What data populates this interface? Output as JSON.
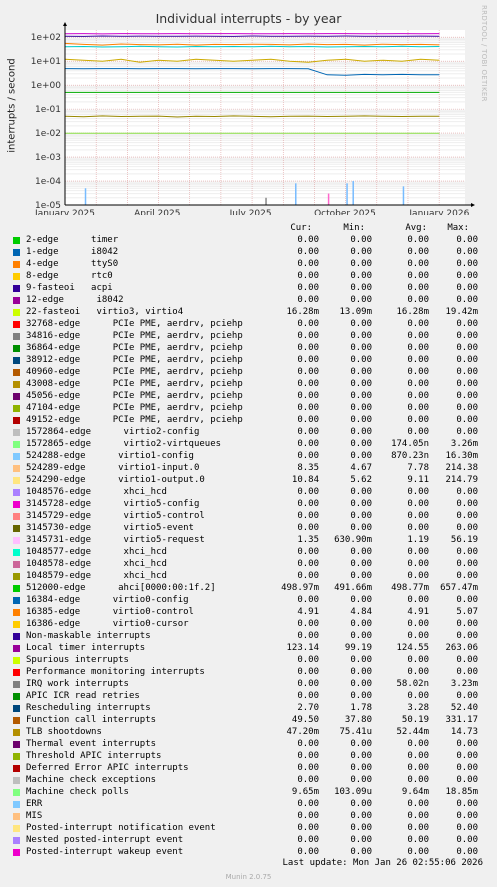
{
  "title": "Individual interrupts - by year",
  "side_label": "RRDTOOL / TOBI OETIKER",
  "footer": {
    "last_update": "Last update: Mon Jan 26 02:55:06 2026",
    "version": "Munin 2.0.75"
  },
  "chart_data": {
    "type": "line",
    "ylabel": "interrupts / second",
    "yscale": "log",
    "ylim": [
      1e-05,
      200
    ],
    "ytick_labels": [
      "1e+02",
      "1e+01",
      "1e+00",
      "1e-01",
      "1e-02",
      "1e-03",
      "1e-04",
      "1e-05"
    ],
    "ytick_values": [
      100,
      10,
      1,
      0.1,
      0.01,
      0.001,
      0.0001,
      1e-05
    ],
    "xtick_labels": [
      "January 2025",
      "April 2025",
      "July 2025",
      "October 2025",
      "January 2026"
    ],
    "xtick_values": [
      0,
      90,
      181,
      273,
      365
    ],
    "xlim": [
      0,
      390
    ],
    "grid": true,
    "series_lines": [
      {
        "color": "#cc00cc",
        "y": [
          140,
          142,
          138,
          141,
          140,
          139,
          141,
          140,
          142,
          141,
          140,
          139,
          141,
          140,
          141,
          142,
          140,
          139,
          141,
          140,
          141
        ]
      },
      {
        "color": "#330099",
        "y": [
          110,
          108,
          112,
          109,
          111,
          110,
          109,
          111,
          110,
          108,
          112,
          110,
          109,
          111,
          110,
          112,
          110,
          109,
          110,
          111,
          110
        ]
      },
      {
        "color": "#00cccc",
        "y": [
          40,
          41,
          39,
          40,
          42,
          40,
          39,
          41,
          40,
          41,
          40,
          42,
          40,
          41,
          39,
          40,
          41,
          40,
          42,
          40,
          41
        ]
      },
      {
        "color": "#ff8000",
        "y": [
          55,
          50,
          47,
          52,
          49,
          48,
          51,
          47,
          50,
          49,
          51,
          50,
          48,
          52,
          49,
          50,
          47,
          51,
          49,
          50,
          48
        ]
      },
      {
        "color": "#ccaa00",
        "y": [
          12,
          11,
          10,
          12,
          9,
          11,
          10,
          12,
          11,
          10,
          11,
          12,
          10,
          9,
          11,
          12,
          10,
          11,
          10,
          12,
          11
        ]
      },
      {
        "color": "#0066b3",
        "y": [
          4.9,
          4.8,
          4.9,
          4.9,
          4.8,
          4.9,
          4.9,
          4.8,
          4.9,
          4.9,
          4.8,
          4.9,
          4.9,
          4.8,
          2.7,
          2.6,
          2.8,
          2.7,
          2.8,
          2.7,
          2.7
        ]
      },
      {
        "color": "#00aa00",
        "y": [
          0.5,
          0.5,
          0.5,
          0.5,
          0.5,
          0.5,
          0.5,
          0.5,
          0.5,
          0.5,
          0.5,
          0.5,
          0.5,
          0.5,
          0.5,
          0.5,
          0.5,
          0.5,
          0.5,
          0.5,
          0.5
        ]
      },
      {
        "color": "#998800",
        "y": [
          0.05,
          0.048,
          0.052,
          0.049,
          0.05,
          0.051,
          0.047,
          0.05,
          0.049,
          0.052,
          0.05,
          0.048,
          0.05,
          0.051,
          0.049,
          0.05,
          0.052,
          0.05,
          0.049,
          0.05,
          0.05
        ]
      },
      {
        "color": "#88dd44",
        "y": [
          0.0098,
          0.0098,
          0.0098,
          0.0098,
          0.0098,
          0.0098,
          0.0098,
          0.0098,
          0.0098,
          0.0098,
          0.0098,
          0.0098,
          0.0098,
          0.0098,
          0.0098,
          0.0098,
          0.0098,
          0.0098,
          0.0098,
          0.0098,
          0.0098
        ]
      }
    ],
    "spikes": [
      {
        "x": 20,
        "y": 5e-05,
        "color": "#77bbff"
      },
      {
        "x": 196,
        "y": 2e-05,
        "color": "#888888"
      },
      {
        "x": 225,
        "y": 8e-05,
        "color": "#77bbff"
      },
      {
        "x": 257,
        "y": 3e-05,
        "color": "#ff66cc"
      },
      {
        "x": 275,
        "y": 8e-05,
        "color": "#77bbff"
      },
      {
        "x": 281,
        "y": 0.0001,
        "color": "#77bbff"
      },
      {
        "x": 330,
        "y": 6e-05,
        "color": "#77bbff"
      }
    ]
  },
  "legend_headers": {
    "cur": "Cur:",
    "min": "Min:",
    "avg": "Avg:",
    "max": "Max:"
  },
  "legend": [
    {
      "label": "2-edge      timer",
      "color": "#00cc00",
      "cur": "0.00",
      "min": "0.00",
      "avg": "0.00",
      "max": "0.00"
    },
    {
      "label": "1-edge      i8042",
      "color": "#0066b3",
      "cur": "0.00",
      "min": "0.00",
      "avg": "0.00",
      "max": "0.00"
    },
    {
      "label": "4-edge      ttyS0",
      "color": "#ff8000",
      "cur": "0.00",
      "min": "0.00",
      "avg": "0.00",
      "max": "0.00"
    },
    {
      "label": "8-edge      rtc0",
      "color": "#ffcc00",
      "cur": "0.00",
      "min": "0.00",
      "avg": "0.00",
      "max": "0.00"
    },
    {
      "label": "9-fasteoi   acpi",
      "color": "#330099",
      "cur": "0.00",
      "min": "0.00",
      "avg": "0.00",
      "max": "0.00"
    },
    {
      "label": "12-edge      i8042",
      "color": "#990099",
      "cur": "0.00",
      "min": "0.00",
      "avg": "0.00",
      "max": "0.00"
    },
    {
      "label": "22-fasteoi   virtio3, virtio4",
      "color": "#ccff00",
      "cur": "16.28m",
      "min": "13.09m",
      "avg": "16.28m",
      "max": "19.42m"
    },
    {
      "label": "32768-edge      PCIe PME, aerdrv, pciehp",
      "color": "#ff0000",
      "cur": "0.00",
      "min": "0.00",
      "avg": "0.00",
      "max": "0.00"
    },
    {
      "label": "34816-edge      PCIe PME, aerdrv, pciehp",
      "color": "#808080",
      "cur": "0.00",
      "min": "0.00",
      "avg": "0.00",
      "max": "0.00"
    },
    {
      "label": "36864-edge      PCIe PME, aerdrv, pciehp",
      "color": "#008f00",
      "cur": "0.00",
      "min": "0.00",
      "avg": "0.00",
      "max": "0.00"
    },
    {
      "label": "38912-edge      PCIe PME, aerdrv, pciehp",
      "color": "#00487d",
      "cur": "0.00",
      "min": "0.00",
      "avg": "0.00",
      "max": "0.00"
    },
    {
      "label": "40960-edge      PCIe PME, aerdrv, pciehp",
      "color": "#b35a00",
      "cur": "0.00",
      "min": "0.00",
      "avg": "0.00",
      "max": "0.00"
    },
    {
      "label": "43008-edge      PCIe PME, aerdrv, pciehp",
      "color": "#b38f00",
      "cur": "0.00",
      "min": "0.00",
      "avg": "0.00",
      "max": "0.00"
    },
    {
      "label": "45056-edge      PCIe PME, aerdrv, pciehp",
      "color": "#6b006b",
      "cur": "0.00",
      "min": "0.00",
      "avg": "0.00",
      "max": "0.00"
    },
    {
      "label": "47104-edge      PCIe PME, aerdrv, pciehp",
      "color": "#8fb300",
      "cur": "0.00",
      "min": "0.00",
      "avg": "0.00",
      "max": "0.00"
    },
    {
      "label": "49152-edge      PCIe PME, aerdrv, pciehp",
      "color": "#b30000",
      "cur": "0.00",
      "min": "0.00",
      "avg": "0.00",
      "max": "0.00"
    },
    {
      "label": "1572864-edge      virtio2-config",
      "color": "#bebebe",
      "cur": "0.00",
      "min": "0.00",
      "avg": "0.00",
      "max": "0.00"
    },
    {
      "label": "1572865-edge      virtio2-virtqueues",
      "color": "#80ff80",
      "cur": "0.00",
      "min": "0.00",
      "avg": "174.05n",
      "max": "3.26m"
    },
    {
      "label": "524288-edge      virtio1-config",
      "color": "#80c9ff",
      "cur": "0.00",
      "min": "0.00",
      "avg": "870.23n",
      "max": "16.30m"
    },
    {
      "label": "524289-edge      virtio1-input.0",
      "color": "#ffc080",
      "cur": "8.35",
      "min": "4.67",
      "avg": "7.78",
      "max": "214.38"
    },
    {
      "label": "524290-edge      virtio1-output.0",
      "color": "#ffe680",
      "cur": "10.84",
      "min": "5.62",
      "avg": "9.11",
      "max": "214.79"
    },
    {
      "label": "1048576-edge      xhci_hcd",
      "color": "#aa80ff",
      "cur": "0.00",
      "min": "0.00",
      "avg": "0.00",
      "max": "0.00"
    },
    {
      "label": "3145728-edge      virtio5-config",
      "color": "#ee00cc",
      "cur": "0.00",
      "min": "0.00",
      "avg": "0.00",
      "max": "0.00"
    },
    {
      "label": "3145729-edge      virtio5-control",
      "color": "#ff8080",
      "cur": "0.00",
      "min": "0.00",
      "avg": "0.00",
      "max": "0.00"
    },
    {
      "label": "3145730-edge      virtio5-event",
      "color": "#666600",
      "cur": "0.00",
      "min": "0.00",
      "avg": "0.00",
      "max": "0.00"
    },
    {
      "label": "3145731-edge      virtio5-request",
      "color": "#ffbfff",
      "cur": "1.35",
      "min": "630.90m",
      "avg": "1.19",
      "max": "56.19"
    },
    {
      "label": "1048577-edge      xhci_hcd",
      "color": "#00ffcc",
      "cur": "0.00",
      "min": "0.00",
      "avg": "0.00",
      "max": "0.00"
    },
    {
      "label": "1048578-edge      xhci_hcd",
      "color": "#cc6699",
      "cur": "0.00",
      "min": "0.00",
      "avg": "0.00",
      "max": "0.00"
    },
    {
      "label": "1048579-edge      xhci_hcd",
      "color": "#999900",
      "cur": "0.00",
      "min": "0.00",
      "avg": "0.00",
      "max": "0.00"
    },
    {
      "label": "512000-edge      ahci[0000:00:1f.2]",
      "color": "#00cc00",
      "cur": "498.97m",
      "min": "491.66m",
      "avg": "498.77m",
      "max": "657.47m"
    },
    {
      "label": "16384-edge      virtio0-config",
      "color": "#0066b3",
      "cur": "0.00",
      "min": "0.00",
      "avg": "0.00",
      "max": "0.00"
    },
    {
      "label": "16385-edge      virtio0-control",
      "color": "#ff8000",
      "cur": "4.91",
      "min": "4.84",
      "avg": "4.91",
      "max": "5.07"
    },
    {
      "label": "16386-edge      virtio0-cursor",
      "color": "#ffcc00",
      "cur": "0.00",
      "min": "0.00",
      "avg": "0.00",
      "max": "0.00"
    },
    {
      "label": "Non-maskable interrupts",
      "color": "#330099",
      "cur": "0.00",
      "min": "0.00",
      "avg": "0.00",
      "max": "0.00"
    },
    {
      "label": "Local timer interrupts",
      "color": "#990099",
      "cur": "123.14",
      "min": "99.19",
      "avg": "124.55",
      "max": "263.06"
    },
    {
      "label": "Spurious interrupts",
      "color": "#ccff00",
      "cur": "0.00",
      "min": "0.00",
      "avg": "0.00",
      "max": "0.00"
    },
    {
      "label": "Performance monitoring interrupts",
      "color": "#ff0000",
      "cur": "0.00",
      "min": "0.00",
      "avg": "0.00",
      "max": "0.00"
    },
    {
      "label": "IRQ work interrupts",
      "color": "#808080",
      "cur": "0.00",
      "min": "0.00",
      "avg": "58.02n",
      "max": "3.23m"
    },
    {
      "label": "APIC ICR read retries",
      "color": "#008f00",
      "cur": "0.00",
      "min": "0.00",
      "avg": "0.00",
      "max": "0.00"
    },
    {
      "label": "Rescheduling interrupts",
      "color": "#00487d",
      "cur": "2.70",
      "min": "1.78",
      "avg": "3.28",
      "max": "52.40"
    },
    {
      "label": "Function call interrupts",
      "color": "#b35a00",
      "cur": "49.50",
      "min": "37.80",
      "avg": "50.19",
      "max": "331.17"
    },
    {
      "label": "TLB shootdowns",
      "color": "#b38f00",
      "cur": "47.20m",
      "min": "75.41u",
      "avg": "52.44m",
      "max": "14.73"
    },
    {
      "label": "Thermal event interrupts",
      "color": "#6b006b",
      "cur": "0.00",
      "min": "0.00",
      "avg": "0.00",
      "max": "0.00"
    },
    {
      "label": "Threshold APIC interrupts",
      "color": "#8fb300",
      "cur": "0.00",
      "min": "0.00",
      "avg": "0.00",
      "max": "0.00"
    },
    {
      "label": "Deferred Error APIC interrupts",
      "color": "#b30000",
      "cur": "0.00",
      "min": "0.00",
      "avg": "0.00",
      "max": "0.00"
    },
    {
      "label": "Machine check exceptions",
      "color": "#bebebe",
      "cur": "0.00",
      "min": "0.00",
      "avg": "0.00",
      "max": "0.00"
    },
    {
      "label": "Machine check polls",
      "color": "#80ff80",
      "cur": "9.65m",
      "min": "103.09u",
      "avg": "9.64m",
      "max": "18.85m"
    },
    {
      "label": "ERR",
      "color": "#80c9ff",
      "cur": "0.00",
      "min": "0.00",
      "avg": "0.00",
      "max": "0.00"
    },
    {
      "label": "MIS",
      "color": "#ffc080",
      "cur": "0.00",
      "min": "0.00",
      "avg": "0.00",
      "max": "0.00"
    },
    {
      "label": "Posted-interrupt notification event",
      "color": "#ffe680",
      "cur": "0.00",
      "min": "0.00",
      "avg": "0.00",
      "max": "0.00"
    },
    {
      "label": "Nested posted-interrupt event",
      "color": "#aa80ff",
      "cur": "0.00",
      "min": "0.00",
      "avg": "0.00",
      "max": "0.00"
    },
    {
      "label": "Posted-interrupt wakeup event",
      "color": "#ee00cc",
      "cur": "0.00",
      "min": "0.00",
      "avg": "0.00",
      "max": "0.00"
    }
  ]
}
